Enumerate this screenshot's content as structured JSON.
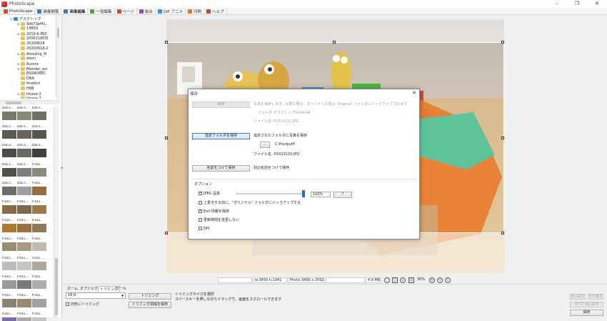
{
  "window": {
    "title": "PhotoScape",
    "minimize": "–",
    "restore": "❐",
    "close": "✕"
  },
  "menu": [
    {
      "label": "PhotoScape",
      "color": "#d84a3c"
    },
    {
      "label": "画像閲覧",
      "color": "#3b7bd4"
    },
    {
      "label": "画像編集",
      "color": "#3b7bd4",
      "active": true
    },
    {
      "label": "一括編集",
      "color": "#59a33c"
    },
    {
      "label": "ページ",
      "color": "#c94b3f"
    },
    {
      "label": "結合",
      "color": "#8a4bc9"
    },
    {
      "label": "GIF アニメ",
      "color": "#3c8fd1"
    },
    {
      "label": "印刷",
      "color": "#d17a3c"
    },
    {
      "label": "ヘルプ",
      "color": "#d13c3c"
    }
  ],
  "tree": [
    {
      "label": "デスクトップ",
      "exp": "⊟",
      "indent": 0,
      "desktop": true
    },
    {
      "label": "9db73ef41...",
      "exp": "⊞",
      "indent": 1
    },
    {
      "label": "13B5S",
      "exp": "",
      "indent": 1
    },
    {
      "label": "2019-6-MIZ",
      "exp": "⊞",
      "indent": 1
    },
    {
      "label": "20061180日",
      "exp": "",
      "indent": 1
    },
    {
      "label": "20200618",
      "exp": "",
      "indent": 1
    },
    {
      "label": "20200618-2",
      "exp": "",
      "indent": 1
    },
    {
      "label": "Amazing_Pi",
      "exp": "⊞",
      "indent": 1
    },
    {
      "label": "atem",
      "exp": "",
      "indent": 1
    },
    {
      "label": "Aurora",
      "exp": "⊞",
      "indent": 1
    },
    {
      "label": "Blender_ani",
      "exp": "⊞",
      "indent": 1
    },
    {
      "label": "BSSNDREC",
      "exp": "",
      "indent": 1
    },
    {
      "label": "DNA",
      "exp": "",
      "indent": 1
    },
    {
      "label": "finefont",
      "exp": "",
      "indent": 1
    },
    {
      "label": "HKB",
      "exp": "",
      "indent": 1
    },
    {
      "label": "Idrave-2",
      "exp": "⊞",
      "indent": 1
    },
    {
      "label": "Idrave-2...",
      "exp": "",
      "indent": 1
    }
  ],
  "thumbnails": [
    {
      "label": "DSCF...",
      "color": "#7a7a6a"
    },
    {
      "label": "DSCF...",
      "color": "#8a8a78"
    },
    {
      "label": "DSCF...",
      "color": "#6e7164"
    },
    {
      "label": "DSCF...",
      "color": "#5c5c52"
    },
    {
      "label": "DSCF...",
      "color": "#6c6358"
    },
    {
      "label": "DSCF...",
      "color": "#56574f"
    },
    {
      "label": "DSCF...",
      "color": "#4b4c46"
    },
    {
      "label": "DSCF...",
      "color": "#6a6a62"
    },
    {
      "label": "DSCF...",
      "color": "#3f403a"
    },
    {
      "label": "DSCF...",
      "color": "#505149"
    },
    {
      "label": "DSCF...",
      "color": "#7b7f86"
    },
    {
      "label": "P101...",
      "color": "#8d8a7c"
    },
    {
      "label": "DSCF...",
      "color": "#6c6d66"
    },
    {
      "label": "DSCF...",
      "color": "#9aa0a6"
    },
    {
      "label": "P101...",
      "color": "#9b6a3c"
    },
    {
      "label": "P101...",
      "color": "#8a6a44"
    },
    {
      "label": "P101...",
      "color": "#7a6a50"
    },
    {
      "label": "P101...",
      "color": "#a07846"
    },
    {
      "label": "P101...",
      "color": "#b0772e"
    },
    {
      "label": "P101...",
      "color": "#9a7040"
    },
    {
      "label": "P101...",
      "color": "#8e7a54"
    },
    {
      "label": "P101...",
      "color": "#9a8c70"
    },
    {
      "label": "P101...",
      "color": "#a89a7c"
    },
    {
      "label": "P101...",
      "color": "#c0b9b0"
    },
    {
      "label": "P101...",
      "color": "#bcbcbc"
    },
    {
      "label": "P101...",
      "color": "#c8c4be"
    },
    {
      "label": "P101...",
      "color": "#b0a89a"
    },
    {
      "label": "P101...",
      "color": "#9a9a9a"
    },
    {
      "label": "P101...",
      "color": "#7a7a7a"
    },
    {
      "label": "P101...",
      "color": "#acacac"
    },
    {
      "label": "P101...",
      "color": "#8a8276"
    },
    {
      "label": "P101...",
      "color": "#9c8a6e"
    },
    {
      "label": "P101...",
      "color": "#a0a0a0"
    },
    {
      "label": "P101...",
      "color": "#7a6ea8"
    },
    {
      "label": "P101...",
      "color": "#b0aab4"
    },
    {
      "label": "P101...",
      "color": "#c4c4c4"
    }
  ],
  "status": {
    "size": "w:3450 h:1941",
    "photo": "Photo 3456 x 2592",
    "filesize": "4.9 MB",
    "zoom": "30%"
  },
  "bottom": {
    "tabs": [
      "ホーム",
      "オブジェクト",
      "トリミング",
      "ツール"
    ],
    "aspect": "16:9",
    "crop_button": "トリミング",
    "save_crop_button": "トリミング領域を保存",
    "round_crop": "円形にトリミング",
    "hint_line1": "トリミングサイズを選択",
    "hint_line2": "スペースキーを押しながらドラッグで、画面をスクロールできます",
    "undo": "元に戻す",
    "redo": "やり直す",
    "undo_all": "すべて元に戻す",
    "save": "保存"
  },
  "dialog": {
    "title": "保存",
    "close": "✕",
    "save_button": "保存",
    "save_desc": "写真を保存します。必要な場合、オリジナル写真は 'Original' フォルダにバックアップされます",
    "folder_label": "フォルダ：",
    "folder_value": "デスクトップ¥sdnrn#",
    "file_label": "ファイル名：",
    "file_value": "P1010110.JPG",
    "save_folder_button": "指定フォルダを保存",
    "save_folder_desc": "指定されたフォルダに写真を保存",
    "browse_button": "...",
    "path_value": "C:¥output¥",
    "filename_label": "ファイル名：",
    "filename_value": "P1010110.JPG",
    "save_as_button": "名前をつけて保存",
    "save_as_desc": "別の名前をつけて保存",
    "options_title": "オプション",
    "jpeg_quality_label": "JPEG 品質",
    "jpeg_quality_value": "100%",
    "jpeg_quality": 1.0,
    "help_button": "?",
    "opt_backup": "上書きする前に、\"オリジナル\" フォルダにバックアップする",
    "opt_exif": "Exif 情報を保持",
    "opt_time": "更新時間を変更しない",
    "opt_dpi": "DPI"
  }
}
